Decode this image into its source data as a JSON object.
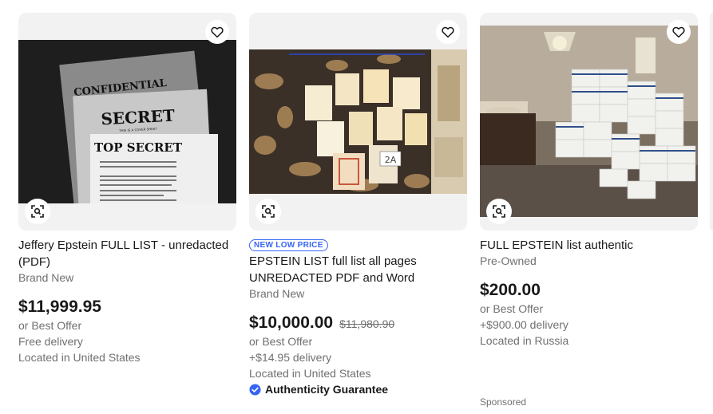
{
  "listings": [
    {
      "title": "Jeffery Epstein FULL LIST - unredacted (PDF)",
      "badge": "",
      "condition": "Brand New",
      "price": "$11,999.95",
      "was_price": "",
      "offer": "or Best Offer",
      "delivery": "Free delivery",
      "location": "Located in United States",
      "guarantee": "",
      "image_text": {
        "confidential": "CONFIDENTIAL",
        "secret": "SECRET",
        "secret_sub": "THIS IS A COVER SHEET",
        "top_secret": "TOP SECRET"
      }
    },
    {
      "title": "EPSTEIN LIST full list all pages UNREDACTED PDF and Word",
      "badge": "NEW LOW PRICE",
      "condition": "Brand New",
      "price": "$10,000.00",
      "was_price": "$11,980.90",
      "offer": "or Best Offer",
      "delivery": "+$14.95 delivery",
      "location": "Located in United States",
      "guarantee": "Authenticity Guarantee",
      "image_text": {
        "tag": "2A"
      }
    },
    {
      "title": "FULL EPSTEIN list authentic",
      "badge": "",
      "condition": "Pre-Owned",
      "price": "$200.00",
      "was_price": "",
      "offer": "or Best Offer",
      "delivery": "+$900.00 delivery",
      "location": "Located in Russia",
      "guarantee": "",
      "sponsored": "Sponsored"
    }
  ],
  "icons": {
    "watch": "heart-icon",
    "visual_search": "visual-search-icon",
    "verified": "verified-check-icon"
  },
  "colors": {
    "accent_blue": "#3665f3",
    "text_primary": "#191919",
    "text_secondary": "#707070",
    "image_bg": "#f2f2f2"
  }
}
